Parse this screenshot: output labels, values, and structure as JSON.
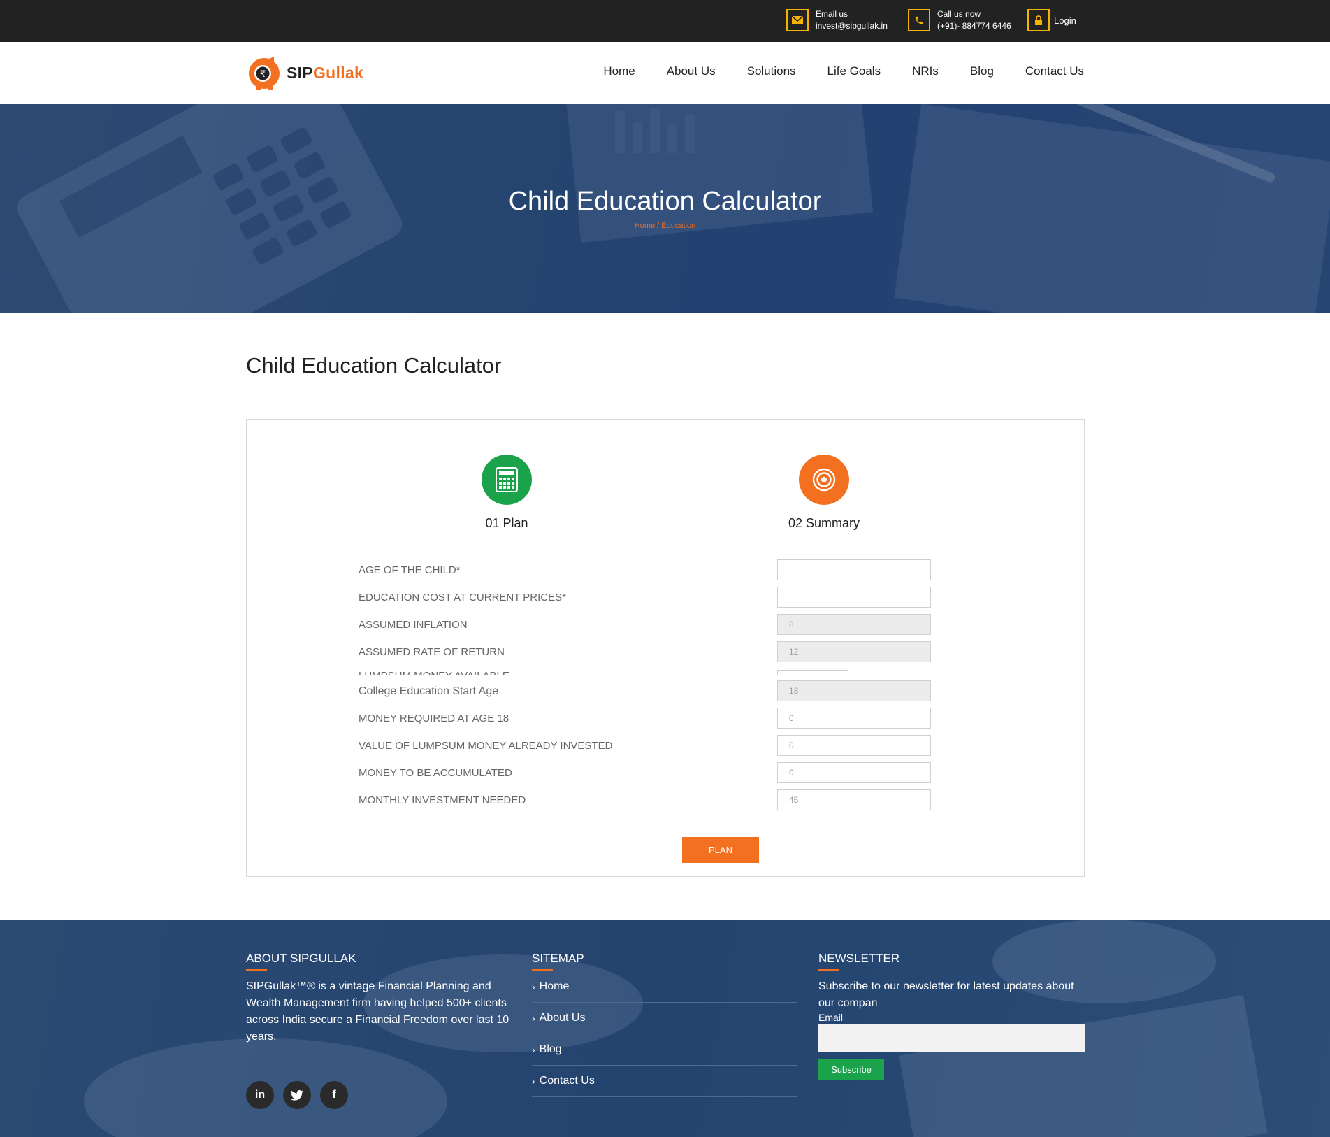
{
  "topbar": {
    "email_label": "Email us",
    "email_value": "invest@sipgullak.in",
    "call_label": "Call us now",
    "call_value": "(+91)- 884774 6446",
    "login_label": "Login",
    "accent_color": "#f5b400"
  },
  "header": {
    "logo_part1": "SIP",
    "logo_part2": "Gullak",
    "nav": [
      "Home",
      "About Us",
      "Solutions",
      "Life Goals",
      "NRIs",
      "Blog",
      "Contact Us"
    ]
  },
  "hero": {
    "title": "Child Education Calculator",
    "breadcrumb_home": "Home",
    "breadcrumb_sep": "/",
    "breadcrumb_current": "Education"
  },
  "main": {
    "title": "Child Education Calculator",
    "steps": [
      {
        "label": "01 Plan",
        "icon": "calculator-icon",
        "color": "#1aa34a"
      },
      {
        "label": "02 Summary",
        "icon": "target-icon",
        "color": "#f37021"
      }
    ],
    "fields": [
      {
        "label": "AGE OF THE CHILD*",
        "value": ""
      },
      {
        "label": "EDUCATION COST AT CURRENT PRICES*",
        "value": ""
      },
      {
        "label": "ASSUMED INFLATION",
        "value": "8"
      },
      {
        "label": "ASSUMED RATE OF RETURN",
        "value": "12"
      },
      {
        "label": "LUMPSUM MONEY AVAILABLE",
        "value": ""
      },
      {
        "label": "College Education Start Age",
        "value": "18"
      },
      {
        "label": "MONEY REQUIRED AT AGE 18",
        "value": "0"
      },
      {
        "label": "VALUE OF LUMPSUM MONEY ALREADY INVESTED",
        "value": "0"
      },
      {
        "label": "MONEY TO BE ACCUMULATED",
        "value": "0"
      },
      {
        "label": "MONTHLY INVESTMENT NEEDED",
        "value": "45"
      }
    ],
    "plan_button": "PLAN",
    "brand_color": "#f37021"
  },
  "footer": {
    "about_heading": "ABOUT SIPGULLAK",
    "about_text": "SIPGullak™® is a vintage Financial Planning and Wealth Management firm having helped 500+ clients across India secure a Financial Freedom over last 10 years.",
    "social": [
      {
        "label": "in",
        "icon": "linkedin-icon"
      },
      {
        "label": "twitter",
        "icon": "twitter-icon"
      },
      {
        "label": "f",
        "icon": "facebook-icon"
      }
    ],
    "sitemap_heading": "SITEMAP",
    "sitemap": [
      "Home",
      "About Us",
      "Blog",
      "Contact Us"
    ],
    "newsletter_heading": "NEWSLETTER",
    "newsletter_text": "Subscribe to our newsletter for latest updates about our compan",
    "email_label": "Email",
    "subscribe_button": "Subscribe"
  }
}
